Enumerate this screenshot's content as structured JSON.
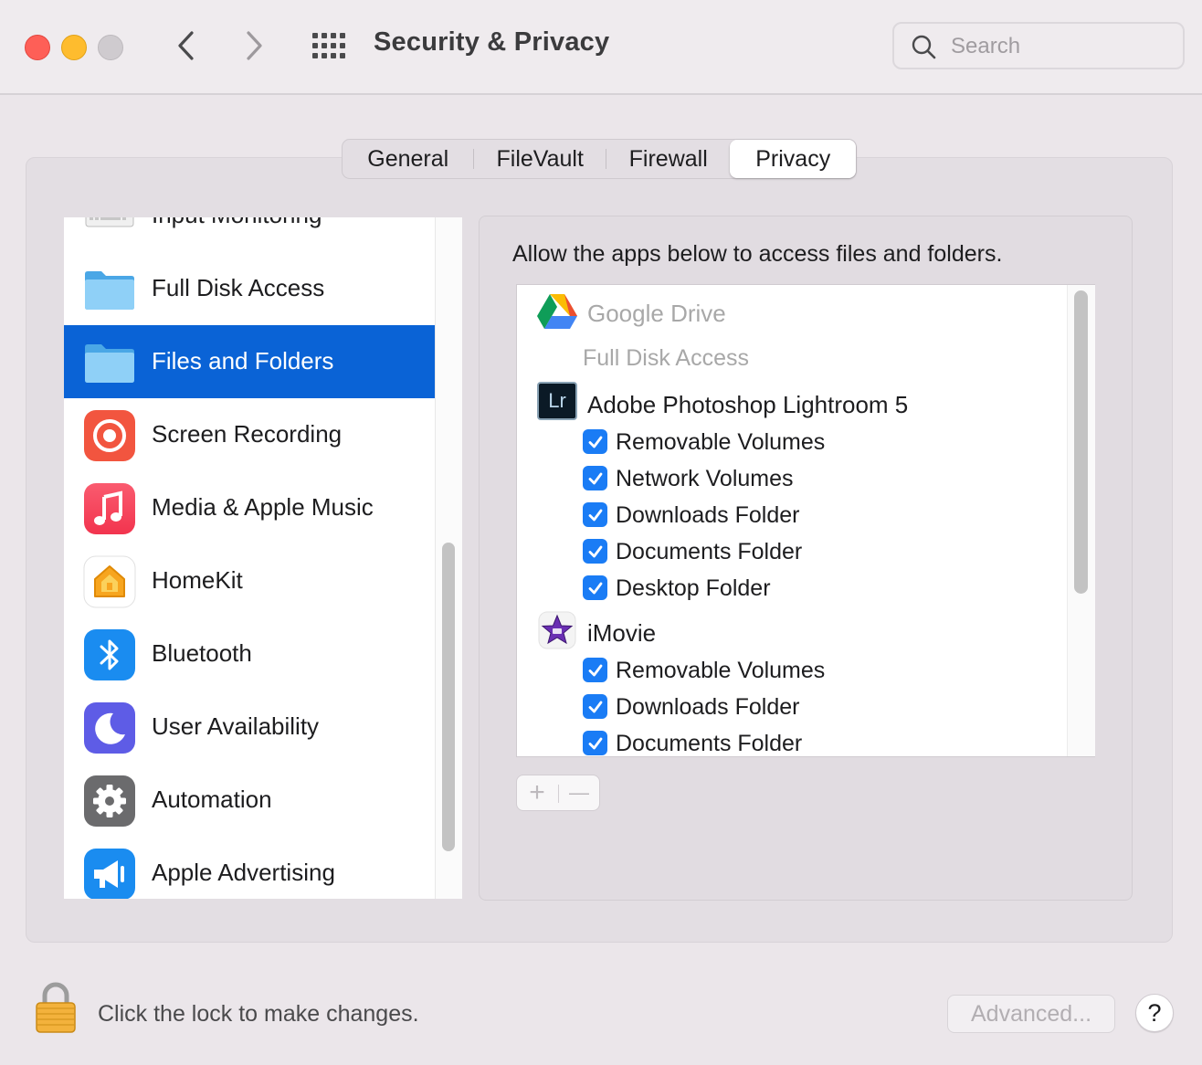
{
  "window": {
    "title": "Security & Privacy",
    "search_placeholder": "Search"
  },
  "tabs": [
    {
      "label": "General",
      "selected": false
    },
    {
      "label": "FileVault",
      "selected": false
    },
    {
      "label": "Firewall",
      "selected": false
    },
    {
      "label": "Privacy",
      "selected": true
    }
  ],
  "sidebar": {
    "items": [
      {
        "label": "Input Monitoring",
        "icon": "keyboard-icon"
      },
      {
        "label": "Full Disk Access",
        "icon": "folder-icon"
      },
      {
        "label": "Files and Folders",
        "icon": "folder-icon",
        "selected": true
      },
      {
        "label": "Screen Recording",
        "icon": "record-icon"
      },
      {
        "label": "Media & Apple Music",
        "icon": "music-note-icon"
      },
      {
        "label": "HomeKit",
        "icon": "home-icon"
      },
      {
        "label": "Bluetooth",
        "icon": "bluetooth-icon"
      },
      {
        "label": "User Availability",
        "icon": "moon-icon"
      },
      {
        "label": "Automation",
        "icon": "gear-icon"
      },
      {
        "label": "Apple Advertising",
        "icon": "megaphone-icon"
      }
    ]
  },
  "panel": {
    "heading": "Allow the apps below to access files and folders.",
    "apps": [
      {
        "name": "Google Drive",
        "dimmed": true,
        "icon": "google-drive-icon",
        "note": "Full Disk Access",
        "permissions": []
      },
      {
        "name": "Adobe Photoshop Lightroom 5",
        "dimmed": false,
        "icon": "lightroom-icon",
        "icon_text": "Lr",
        "permissions": [
          {
            "label": "Removable Volumes",
            "checked": true
          },
          {
            "label": "Network Volumes",
            "checked": true
          },
          {
            "label": "Downloads Folder",
            "checked": true
          },
          {
            "label": "Documents Folder",
            "checked": true
          },
          {
            "label": "Desktop Folder",
            "checked": true
          }
        ]
      },
      {
        "name": "iMovie",
        "dimmed": false,
        "icon": "imovie-star-icon",
        "permissions": [
          {
            "label": "Removable Volumes",
            "checked": true
          },
          {
            "label": "Downloads Folder",
            "checked": true
          },
          {
            "label": "Documents Folder",
            "checked": true
          }
        ]
      }
    ],
    "add_label": "+",
    "remove_label": "—"
  },
  "footer": {
    "lock_text": "Click the lock to make changes.",
    "advanced_label": "Advanced...",
    "help_label": "?"
  },
  "colors": {
    "selection": "#0a63d6",
    "checkbox": "#1a7cf5",
    "close": "#fe5f57",
    "minimize": "#febc2e"
  }
}
